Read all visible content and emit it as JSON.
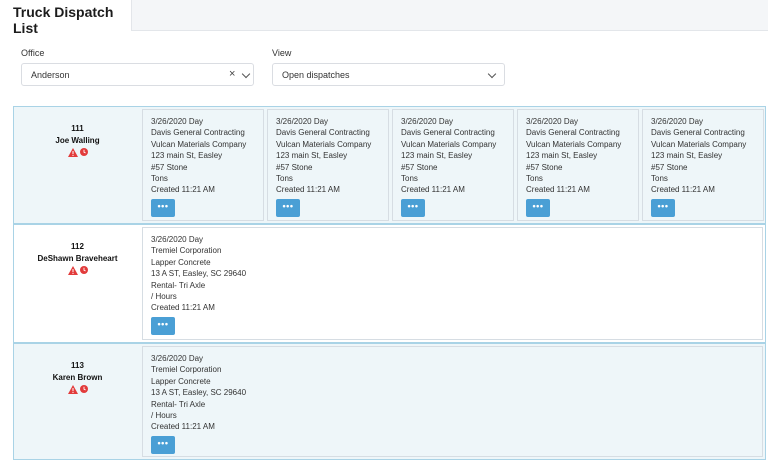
{
  "page": {
    "title": "Truck Dispatch List"
  },
  "filters": {
    "office_label": "Office",
    "office_value": "Anderson",
    "office_clear": "×",
    "view_label": "View",
    "view_value": "Open dispatches"
  },
  "more_label": "•••",
  "trucks": [
    {
      "number": "111",
      "driver": "Joe Walling",
      "dispatches": [
        {
          "lines": [
            "3/26/2020 Day",
            "Davis General Contracting",
            "Vulcan Materials Company",
            "123 main St, Easley",
            "#57 Stone",
            "Tons",
            "Created 11:21 AM"
          ]
        },
        {
          "lines": [
            "3/26/2020 Day",
            "Davis General Contracting",
            "Vulcan Materials Company",
            "123 main St, Easley",
            "#57 Stone",
            "Tons",
            "Created 11:21 AM"
          ]
        },
        {
          "lines": [
            "3/26/2020 Day",
            "Davis General Contracting",
            "Vulcan Materials Company",
            "123 main St, Easley",
            "#57 Stone",
            "Tons",
            "Created 11:21 AM"
          ]
        },
        {
          "lines": [
            "3/26/2020 Day",
            "Davis General Contracting",
            "Vulcan Materials Company",
            "123 main St, Easley",
            "#57 Stone",
            "Tons",
            "Created 11:21 AM"
          ]
        },
        {
          "lines": [
            "3/26/2020 Day",
            "Davis General Contracting",
            "Vulcan Materials Company",
            "123 main St, Easley",
            "#57 Stone",
            "Tons",
            "Created 11:21 AM"
          ]
        }
      ]
    },
    {
      "number": "112",
      "driver": "DeShawn Braveheart",
      "dispatches": [
        {
          "lines": [
            "3/26/2020 Day",
            "Tremiel Corporation",
            "Lapper Concrete",
            "13 A ST, Easley, SC 29640",
            "Rental- Tri Axle",
            "/ Hours",
            "Created 11:21 AM"
          ]
        }
      ]
    },
    {
      "number": "113",
      "driver": "Karen Brown",
      "dispatches": [
        {
          "lines": [
            "3/26/2020 Day",
            "Tremiel Corporation",
            "Lapper Concrete",
            "13 A ST, Easley, SC 29640",
            "Rental- Tri Axle",
            "/ Hours",
            "Created 11:21 AM"
          ]
        }
      ]
    }
  ],
  "icons": {
    "warning": "warning-triangle-icon",
    "clock": "clock-icon"
  },
  "colors": {
    "accent": "#4a9fd5",
    "row_border": "#a9d3e6",
    "row_shade": "#eef6f9",
    "alert": "#e23b3b"
  }
}
